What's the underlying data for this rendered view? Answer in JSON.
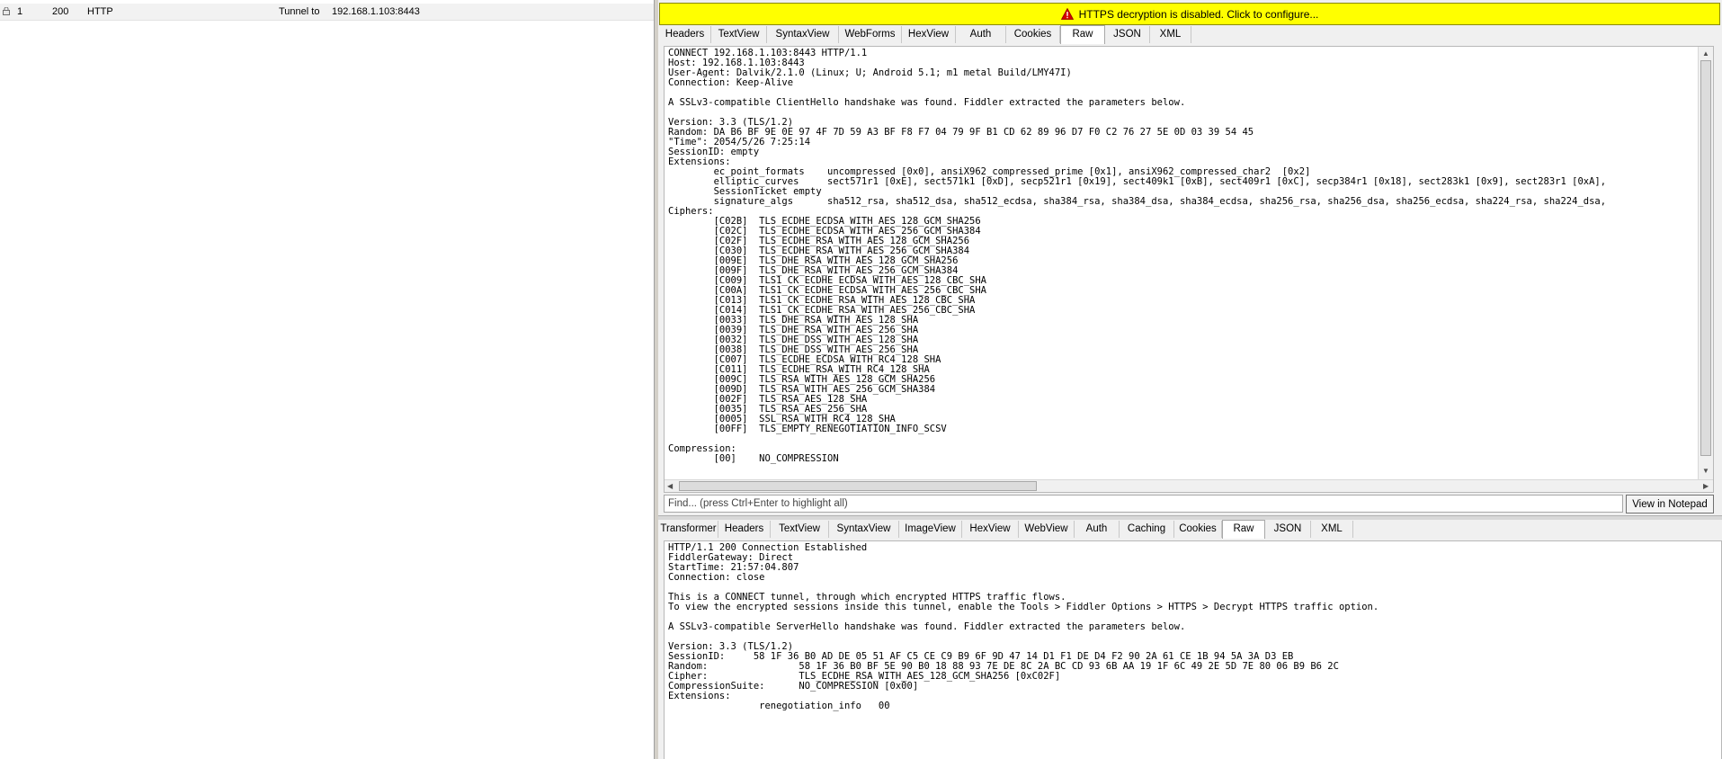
{
  "sessions": [
    {
      "num": "1",
      "result": "200",
      "protocol": "HTTP",
      "host": "Tunnel to",
      "url": "192.168.1.103:8443"
    }
  ],
  "banner": {
    "text": "HTTPS decryption is disabled. Click to configure...",
    "color": "#ffff00",
    "icon": "warning-icon"
  },
  "request": {
    "tabs": [
      "Headers",
      "TextView",
      "SyntaxView",
      "WebForms",
      "HexView",
      "Auth",
      "Cookies",
      "Raw",
      "JSON",
      "XML"
    ],
    "active_tab": "Raw",
    "lines": [
      "CONNECT 192.168.1.103:8443 HTTP/1.1",
      "Host: 192.168.1.103:8443",
      "User-Agent: Dalvik/2.1.0 (Linux; U; Android 5.1; m1 metal Build/LMY47I)",
      "Connection: Keep-Alive",
      "",
      "A SSLv3-compatible ClientHello handshake was found. Fiddler extracted the parameters below.",
      "",
      "Version: 3.3 (TLS/1.2)",
      "Random: DA B6 BF 9E 0E 97 4F 7D 59 A3 BF F8 F7 04 79 9F B1 CD 62 89 96 D7 F0 C2 76 27 5E 0D 03 39 54 45",
      "\"Time\": 2054/5/26 7:25:14",
      "SessionID: empty",
      "Extensions:",
      "        ec_point_formats    uncompressed [0x0], ansiX962_compressed_prime [0x1], ansiX962_compressed_char2  [0x2]",
      "        elliptic_curves     sect571r1 [0xE], sect571k1 [0xD], secp521r1 [0x19], sect409k1 [0xB], sect409r1 [0xC], secp384r1 [0x18], sect283k1 [0x9], sect283r1 [0xA],",
      "        SessionTicket empty",
      "        signature_algs      sha512_rsa, sha512_dsa, sha512_ecdsa, sha384_rsa, sha384_dsa, sha384_ecdsa, sha256_rsa, sha256_dsa, sha256_ecdsa, sha224_rsa, sha224_dsa,",
      "Ciphers:",
      "        [C02B]  TLS_ECDHE_ECDSA_WITH_AES_128_GCM_SHA256",
      "        [C02C]  TLS_ECDHE_ECDSA_WITH_AES_256_GCM_SHA384",
      "        [C02F]  TLS_ECDHE_RSA_WITH_AES_128_GCM_SHA256",
      "        [C030]  TLS_ECDHE_RSA_WITH_AES_256_GCM_SHA384",
      "        [009E]  TLS_DHE_RSA_WITH_AES_128_GCM_SHA256",
      "        [009F]  TLS_DHE_RSA_WITH_AES_256_GCM_SHA384",
      "        [C009]  TLS1_CK_ECDHE_ECDSA_WITH_AES_128_CBC_SHA",
      "        [C00A]  TLS1_CK_ECDHE_ECDSA_WITH_AES_256_CBC_SHA",
      "        [C013]  TLS1_CK_ECDHE_RSA_WITH_AES_128_CBC_SHA",
      "        [C014]  TLS1_CK_ECDHE_RSA_WITH_AES_256_CBC_SHA",
      "        [0033]  TLS_DHE_RSA_WITH_AES_128_SHA",
      "        [0039]  TLS_DHE_RSA_WITH_AES_256_SHA",
      "        [0032]  TLS_DHE_DSS_WITH_AES_128_SHA",
      "        [0038]  TLS_DHE_DSS_WITH_AES_256_SHA",
      "        [C007]  TLS_ECDHE_ECDSA_WITH_RC4_128_SHA",
      "        [C011]  TLS_ECDHE_RSA_WITH_RC4_128_SHA",
      "        [009C]  TLS_RSA_WITH_AES_128_GCM_SHA256",
      "        [009D]  TLS_RSA_WITH_AES_256_GCM_SHA384",
      "        [002F]  TLS_RSA_AES_128_SHA",
      "        [0035]  TLS_RSA_AES_256_SHA",
      "        [0005]  SSL_RSA_WITH_RC4_128_SHA",
      "        [00FF]  TLS_EMPTY_RENEGOTIATION_INFO_SCSV",
      "",
      "Compression:",
      "        [00]    NO_COMPRESSION"
    ],
    "find_placeholder": "Find... (press Ctrl+Enter to highlight all)",
    "notepad_label": "View in Notepad"
  },
  "response": {
    "tabs": [
      "Transformer",
      "Headers",
      "TextView",
      "SyntaxView",
      "ImageView",
      "HexView",
      "WebView",
      "Auth",
      "Caching",
      "Cookies",
      "Raw",
      "JSON",
      "XML"
    ],
    "active_tab": "Raw",
    "lines": [
      "HTTP/1.1 200 Connection Established",
      "FiddlerGateway: Direct",
      "StartTime: 21:57:04.807",
      "Connection: close",
      "",
      "This is a CONNECT tunnel, through which encrypted HTTPS traffic flows.",
      "To view the encrypted sessions inside this tunnel, enable the Tools > Fiddler Options > HTTPS > Decrypt HTTPS traffic option.",
      "",
      "A SSLv3-compatible ServerHello handshake was found. Fiddler extracted the parameters below.",
      "",
      "Version: 3.3 (TLS/1.2)",
      "SessionID:     58 1F 36 B0 AD DE 05 51 AF C5 CE C9 B9 6F 9D 47 14 D1 F1 DE D4 F2 90 2A 61 CE 1B 94 5A 3A D3 EB",
      "Random:                58 1F 36 B0 BF 5E 90 B0 18 88 93 7E DE 8C 2A BC CD 93 6B AA 19 1F 6C 49 2E 5D 7E 80 06 B9 B6 2C",
      "Cipher:                TLS_ECDHE_RSA_WITH_AES_128_GCM_SHA256 [0xC02F]",
      "CompressionSuite:      NO_COMPRESSION [0x00]",
      "Extensions:",
      "                renegotiation_info   00"
    ]
  }
}
